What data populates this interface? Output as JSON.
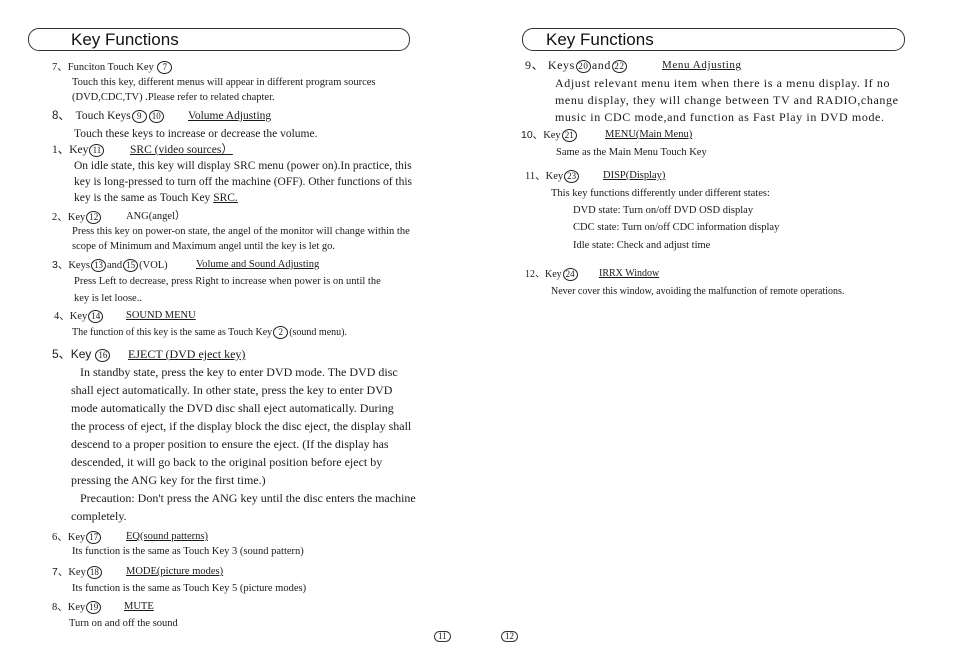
{
  "left": {
    "title": "Key Functions",
    "items": [
      {
        "num": "7、",
        "label": "Funciton Touch Key",
        "keys": [
          "7"
        ],
        "title": "",
        "lines": [
          "Touch this key, different menus will appear in different program sources",
          "(DVD,CDC,TV)  .Please refer to related chapter."
        ]
      },
      {
        "num": "8、",
        "label": "Touch Keys",
        "keys": [
          "9",
          "10"
        ],
        "title": "Volume Adjusting",
        "lines": [
          "Touch these keys to increase or decrease the volume."
        ]
      },
      {
        "num": "1、",
        "label": "Key",
        "keys": [
          "11"
        ],
        "title": "SRC (video sources）",
        "lines": [
          "On idle state, this key will display SRC menu (power on).In practice, this",
          "key is long-pressed to turn off the machine (OFF). Other functions of this",
          "key is the same as Touch Key "
        ],
        "link": "SRC."
      },
      {
        "num": "2、",
        "label": "Key",
        "keys": [
          "12"
        ],
        "title": "ANG(angel）",
        "lines": [
          "Press this key on power-on state, the angel of the monitor will change within the",
          "scope of Minimum and Maximum angel until the key is let go."
        ]
      },
      {
        "num": "3、",
        "label": "Keys",
        "keys": [
          "13",
          "15"
        ],
        "and": "and",
        "suffix": "(VOL)",
        "title": "Volume and Sound Adjusting",
        "lines": [
          "Press Left to decrease, press Right to increase when power is on until the",
          "key is let loose.."
        ]
      },
      {
        "num": "4、",
        "label": "Key",
        "keys": [
          "14",
          "2"
        ],
        "title": "SOUND MENU",
        "lines": [
          "The function of this key is the same as Touch Key",
          "(sound menu)."
        ]
      },
      {
        "num": "5、",
        "label": "Key",
        "keys": [
          "16"
        ],
        "title": "EJECT (DVD eject key)",
        "lines": [
          "In standby state, press the key to enter DVD mode. The DVD disc",
          "shall eject automatically. In other state, press the key to enter DVD",
          "mode automatically the DVD disc shall eject automatically. During",
          "the process of eject, if the display block the disc eject, the display shall",
          "descend to a proper position to ensure the eject. (If the display has",
          "descended, it will go back to the original position before eject by",
          "pressing the ANG key for the first time.)",
          "Precaution: Don't press the ANG key until the disc enters the machine",
          "completely."
        ]
      },
      {
        "num": "6、",
        "label": "Key",
        "keys": [
          "17"
        ],
        "title": "EQ(sound patterns)",
        "lines": [
          "Its function is the same as Touch Key 3 (sound pattern)"
        ]
      },
      {
        "num": "7、",
        "label": "Key",
        "keys": [
          "18"
        ],
        "title": "MODE(picture modes)",
        "lines": [
          "Its function is the same as Touch Key 5 (picture modes)"
        ]
      },
      {
        "num": "8、",
        "label": "Key",
        "keys": [
          "19"
        ],
        "title": "MUTE",
        "lines": [
          "Turn on and off the sound"
        ]
      }
    ],
    "page_number": "11"
  },
  "right": {
    "title": "Key Functions",
    "items": [
      {
        "num": "9、",
        "label": "Keys",
        "keys": [
          "20",
          "22"
        ],
        "and": "and",
        "title": "Menu Adjusting",
        "lines": [
          "Adjust relevant menu item when there is a menu display. If no",
          "menu display, they will change between TV and RADIO,change",
          "music in CDC mode,and function as Fast Play in DVD mode."
        ]
      },
      {
        "num": "10、",
        "label": "Key",
        "keys": [
          "21"
        ],
        "title": "MENU(Main Menu)",
        "lines": [
          "Same as the Main Menu Touch Key"
        ]
      },
      {
        "num": "11、",
        "label": "Key",
        "keys": [
          "23"
        ],
        "title": "DISP(Display)",
        "lines": [
          "This key functions differently under different states:",
          "DVD state:  Turn on/off DVD OSD display",
          "CDC state:  Turn on/off CDC information display",
          "Idle state: Check and adjust time"
        ]
      },
      {
        "num": "12、",
        "label": "Key",
        "keys": [
          "24"
        ],
        "title": "IRRX Window",
        "lines": [
          "Never cover this window, avoiding the malfunction of remote operations."
        ]
      }
    ],
    "page_number": "12"
  }
}
